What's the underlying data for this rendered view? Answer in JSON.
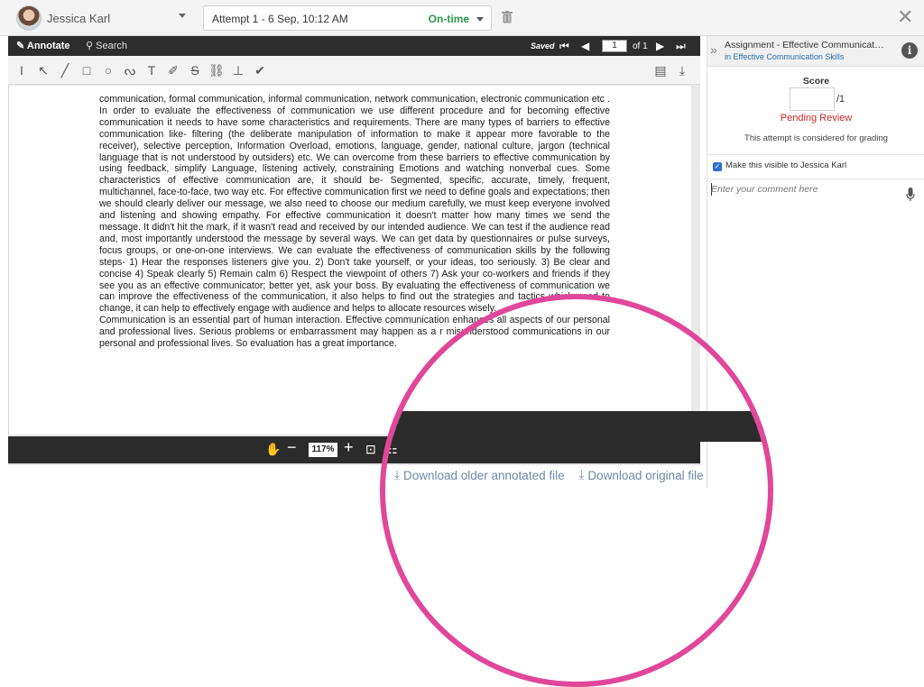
{
  "topbar": {
    "user_name": "Jessica Karl",
    "attempt_label": "Attempt 1 - 6 Sep, 10:12 AM",
    "attempt_status": "On-time"
  },
  "viewer": {
    "annotate_label": "Annotate",
    "search_label": "Search",
    "saved_label": "Saved",
    "page_current": "1",
    "page_of": "of 1",
    "zoom": "117%",
    "paragraph_1": "communication, formal communication, informal communication, network communication, electronic communication etc . In order to evaluate the effectiveness of communication we use different procedure and for becoming effective communication it needs to have some characteristics and requirements. There are many types of barriers to effective communication like- filtering (the deliberate manipulation of information to make it appear more favorable to the receiver), selective perception, Information Overload, emotions, language, gender, national culture, jargon (technical language that is not understood by outsiders) etc. We can overcome from these barriers to effective communication by using feedback, simplify Language, listening actively, constraining Emotions and watching nonverbal cues. Some characteristics of effective communication are, it should be- Segmented, specific, accurate, timely, frequent, multichannel, face-to-face, two way etc. For effective communication first we need to define goals and expectations; then we should clearly deliver our message, we also need to choose our medium carefully, we must keep everyone involved and listening and showing empathy. For effective communication it doesn't matter how many times we send the message. It didn't hit the mark, if it wasn't read and received by our intended audience. We can test if the audience read and, most importantly understood the message by several ways. We can get data by questionnaires or pulse surveys, focus groups, or one-on-one interviews. We can evaluate the effectiveness of communication skills by the following steps- 1) Hear the responses listeners give you. 2) Don't take yourself, or your ideas, too seriously. 3) Be clear and concise 4) Speak clearly 5) Remain calm 6) Respect the viewpoint of others 7) Ask your co-workers and friends if they see you as an effective communicator; better yet, ask your boss. By evaluating the effectiveness of communication we can improve the effectiveness of the communication, it also helps to find out the strategies and tactics which need to change, it can help to effectively engage with audience and helps to allocate resources wisely.",
    "paragraph_2": "Communication is an essential part of human interaction. Effective communication enhances all aspects of our personal and professional lives. Serious problems or embarrassment may happen as a r misunderstood communications in our personal and professional lives. So evaluation has a great importance."
  },
  "panel": {
    "assignment_title": "Assignment - Effective Communicatio...",
    "in_label": "in",
    "course_name": "Effective Communication Skills",
    "score_label": "Score",
    "score_value": "",
    "score_max": "/1",
    "pending_label": "Pending Review",
    "grading_note": "This attempt is considered for grading",
    "visible_label": "Make this visible to Jessica Karl",
    "comment_placeholder": "Enter your comment here"
  },
  "downloads": {
    "older_label": "Download older annotated file",
    "original_label": "Download original file"
  },
  "colors": {
    "on_time": "#2c9b4f",
    "pending": "#c62828",
    "link": "#2a6aa8",
    "highlight_ring": "#e0479a"
  }
}
